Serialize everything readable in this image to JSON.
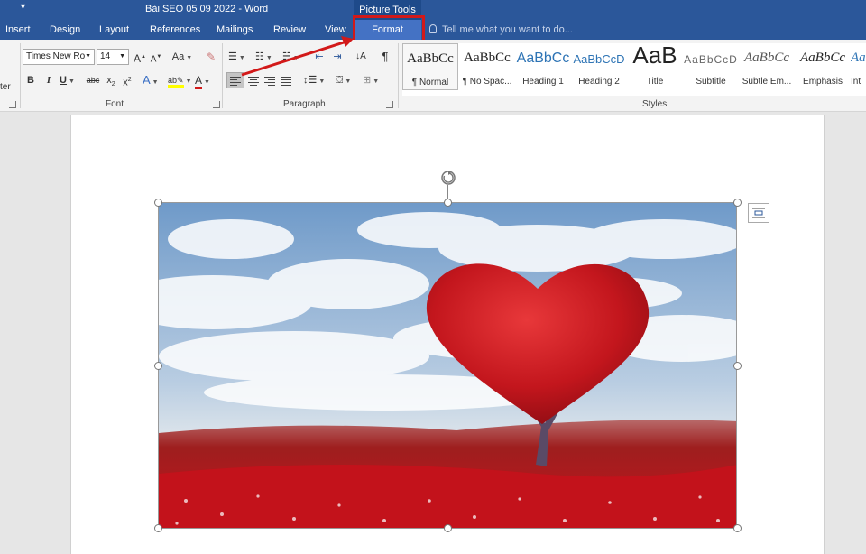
{
  "window": {
    "title": "Bài SEO 05 09 2022 - Word",
    "contextual_tab_group": "Picture Tools"
  },
  "tabs": [
    "Insert",
    "Design",
    "Layout",
    "References",
    "Mailings",
    "Review",
    "View",
    "Format"
  ],
  "tell_me": {
    "placeholder": "Tell me what you want to do..."
  },
  "clipboard": {
    "partial_label": "ter"
  },
  "font_group": {
    "label": "Font",
    "font_name": "Times New Ro",
    "font_size": "14",
    "grow_font": "A",
    "shrink_font": "A",
    "change_case": "Aa",
    "bold": "B",
    "italic": "I",
    "underline": "U",
    "strikethrough": "abc",
    "subscript": "x",
    "superscript": "x",
    "text_effects": "A",
    "font_color": "A",
    "font_color_value": "#d21919",
    "highlight_color_value": "#ffff00"
  },
  "paragraph_group": {
    "label": "Paragraph",
    "pilcrow": "¶"
  },
  "styles_group": {
    "label": "Styles",
    "items": [
      {
        "preview": "AaBbCc",
        "name": "¶ Normal",
        "selected": true
      },
      {
        "preview": "AaBbCc",
        "name": "¶ No Spac..."
      },
      {
        "preview": "AaBbCc",
        "name": "Heading 1"
      },
      {
        "preview": "AaBbCcD",
        "name": "Heading 2"
      },
      {
        "preview": "AaB",
        "name": "Title"
      },
      {
        "preview": "AaBbCcD",
        "name": "Subtitle"
      },
      {
        "preview": "AaBbCc",
        "name": "Subtle Em..."
      },
      {
        "preview": "AaBbCc",
        "name": "Emphasis"
      },
      {
        "preview": "Aa",
        "name": "Int"
      }
    ]
  },
  "colors": {
    "ribbon_blue": "#2b579a",
    "format_tab": "#4472c4",
    "annotation_red": "#d21919"
  },
  "icons": [
    "rotate-icon",
    "layout-options-icon",
    "format-painter-icon",
    "lightbulb-icon"
  ],
  "image": {
    "description_only": true
  }
}
